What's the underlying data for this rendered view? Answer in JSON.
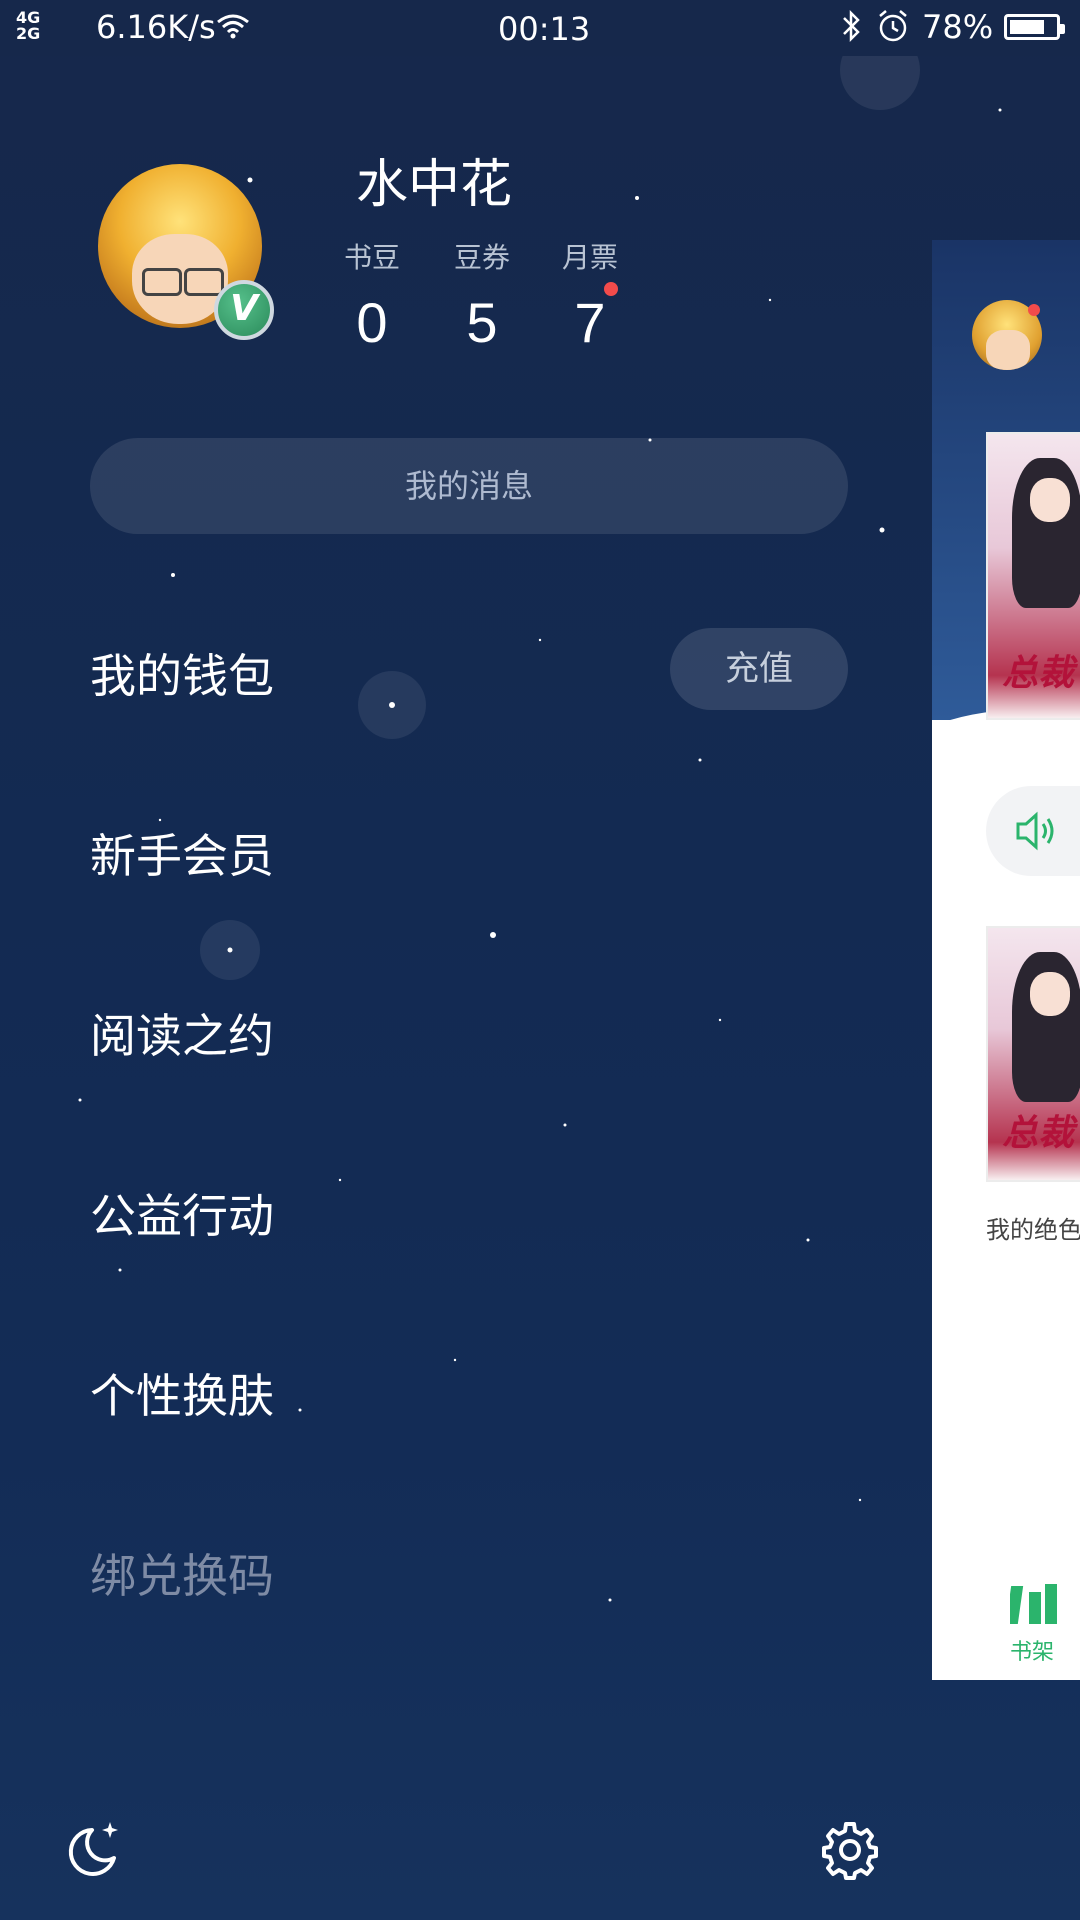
{
  "status_bar": {
    "network": "4G\n2G",
    "speed": "6.16K/s",
    "time": "00:13",
    "battery": "78%",
    "battery_level": 0.78
  },
  "profile": {
    "username": "水中花",
    "badge": "V",
    "stats": [
      {
        "label": "书豆",
        "value": "0"
      },
      {
        "label": "豆券",
        "value": "5"
      },
      {
        "label": "月票",
        "value": "7"
      }
    ]
  },
  "messages_button": "我的消息",
  "menu": [
    {
      "label": "我的钱包"
    },
    {
      "label": "新手会员"
    },
    {
      "label": "阅读之约"
    },
    {
      "label": "公益行动"
    },
    {
      "label": "个性换肤"
    },
    {
      "label": "绑兑换码"
    }
  ],
  "recharge_button": "充值",
  "bottom_icons": {
    "left": "moon-star-icon",
    "right": "gear-icon"
  },
  "background_panel": {
    "cover_title": "总裁",
    "book_title": "我的绝色",
    "tab_label": "书架",
    "accent_color": "#2bb46c"
  },
  "colors": {
    "background": "#14294f",
    "notify_dot": "#f24b4b"
  }
}
